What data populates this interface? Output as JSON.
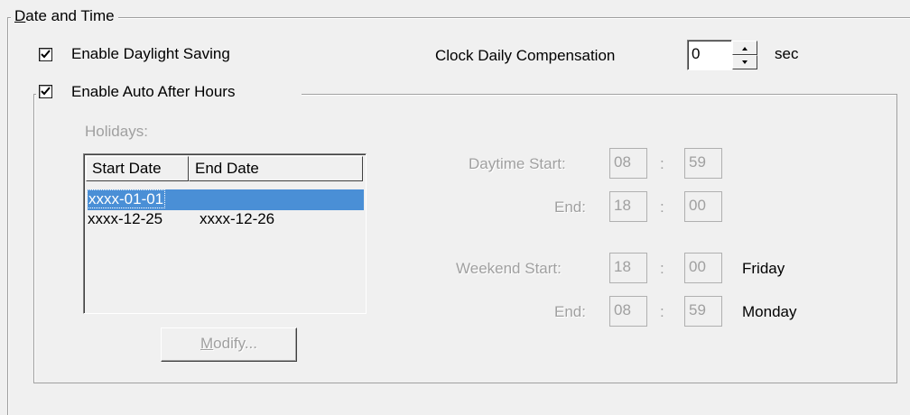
{
  "date_time": {
    "group_label": "Date and Time",
    "enable_dst": {
      "label": "Enable Daylight Saving",
      "checked": true
    },
    "clock_comp": {
      "label": "Clock Daily Compensation",
      "value": "0",
      "unit": "sec"
    }
  },
  "after_hours": {
    "enable": {
      "label": "Enable Auto After Hours",
      "checked": true
    },
    "holidays_label": "Holidays:",
    "columns": [
      "Start Date",
      "End Date"
    ],
    "rows": [
      {
        "start": "xxxx-01-01",
        "end": "",
        "selected": true
      },
      {
        "start": "xxxx-12-25",
        "end": "xxxx-12-26",
        "selected": false
      }
    ],
    "modify_button": "Modify...",
    "daytime": {
      "start_label": "Daytime Start:",
      "start_hh": "08",
      "start_mm": "59",
      "end_label": "End:",
      "end_hh": "18",
      "end_mm": "00"
    },
    "weekend": {
      "start_label": "Weekend Start:",
      "start_hh": "18",
      "start_mm": "00",
      "start_day": "Friday",
      "end_label": "End:",
      "end_hh": "08",
      "end_mm": "59",
      "end_day": "Monday"
    },
    "time_separator": ":"
  },
  "colors": {
    "selection": "#4a8fd6",
    "disabled_text": "#a0a0a0",
    "dialog_bg": "#f0f0f0"
  }
}
